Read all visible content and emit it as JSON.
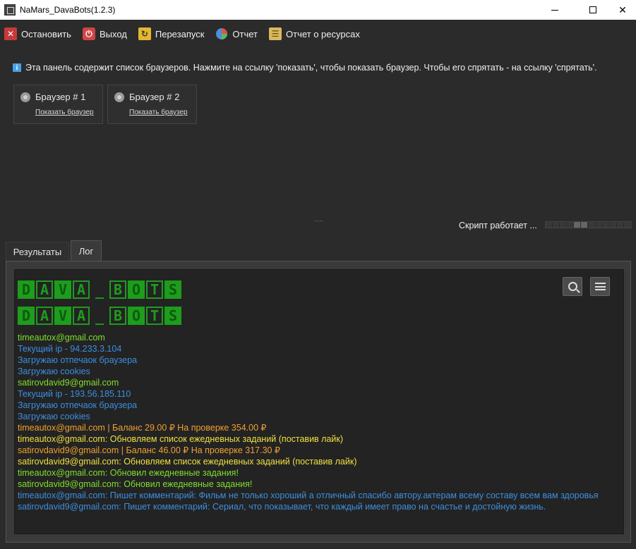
{
  "window": {
    "title": "NaMars_DavaBots(1.2.3)",
    "minimize": "—",
    "close": "✕"
  },
  "toolbar": {
    "stop": "Остановить",
    "exit": "Выход",
    "restart": "Перезапуск",
    "report": "Отчет",
    "resource_report": "Отчет о ресурсах"
  },
  "info": {
    "text": "Эта панель содержит список браузеров. Нажмите на ссылку 'показать', чтобы показать браузер. Чтобы его спрятать - на ссылку 'спрятать'."
  },
  "browsers": [
    {
      "name": "Браузер # 1",
      "link": "Показать браузер"
    },
    {
      "name": "Браузер # 2",
      "link": "Показать браузер"
    }
  ],
  "splitter": ".....",
  "status": {
    "text": "Скрипт работает ...",
    "progress_active_cells": [
      4,
      5
    ]
  },
  "tabs": {
    "results": "Результаты",
    "log": "Лог",
    "active": "log"
  },
  "logo": {
    "row1": [
      "D",
      "A",
      "V",
      "A",
      "_",
      "B",
      "O",
      "T",
      "S"
    ],
    "row2": [
      "D",
      "A",
      "V",
      "A",
      "_",
      "B",
      "O",
      "T",
      "S"
    ]
  },
  "log": [
    {
      "text": "timeautox@gmail.com",
      "color": "green"
    },
    {
      "text": "Текущий ip - 94.233.3.104",
      "color": "blue"
    },
    {
      "text": "Загружаю отпечаок браузера",
      "color": "blue"
    },
    {
      "text": "Загружаю cookies",
      "color": "blue"
    },
    {
      "text": "satirovdavid9@gmail.com",
      "color": "green"
    },
    {
      "text": "Текущий ip - 193.56.185.110",
      "color": "blue"
    },
    {
      "text": "Загружаю отпечаок браузера",
      "color": "blue"
    },
    {
      "text": "Загружаю cookies",
      "color": "blue"
    },
    {
      "text": "timeautox@gmail.com | Баланс 29.00 ₽ На проверке 354.00 ₽",
      "color": "orange"
    },
    {
      "text": "timeautox@gmail.com: Обновляем список ежедневных заданий (поставив лайк)",
      "color": "yellow"
    },
    {
      "text": "satirovdavid9@gmail.com | Баланс 46.00 ₽ На проверке 317.30 ₽",
      "color": "orange"
    },
    {
      "text": "satirovdavid9@gmail.com: Обновляем список ежедневных заданий (поставив лайк)",
      "color": "yellow"
    },
    {
      "text": "timeautox@gmail.com: Обновил ежедневные задания!",
      "color": "green"
    },
    {
      "text": "satirovdavid9@gmail.com: Обновил ежедневные задания!",
      "color": "green"
    },
    {
      "text": "timeautox@gmail.com: Пишет комментарий: Фильм не только хороший а отличный спасибо автору.актерам всему составу всем вам здоровья",
      "color": "blue"
    },
    {
      "text": "satirovdavid9@gmail.com: Пишет комментарий: Сериал, что показывает, что каждый имеет право на счастье и достойную жизнь.",
      "color": "blue"
    }
  ],
  "colors": {
    "green": "#7fdf2c",
    "blue": "#3b8fe0",
    "orange": "#f0a030",
    "yellow": "#f0e040",
    "logo_green": "#1e9c1e"
  }
}
